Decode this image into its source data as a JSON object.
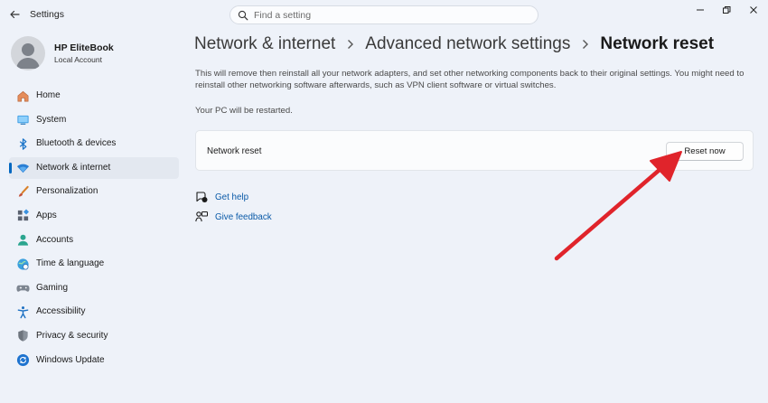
{
  "window": {
    "title": "Settings",
    "search_placeholder": "Find a setting"
  },
  "profile": {
    "name": "HP EliteBook",
    "account_type": "Local Account"
  },
  "sidebar": {
    "items": [
      {
        "label": "Home",
        "icon": "home-icon"
      },
      {
        "label": "System",
        "icon": "system-monitor-icon"
      },
      {
        "label": "Bluetooth & devices",
        "icon": "bluetooth-icon"
      },
      {
        "label": "Network & internet",
        "icon": "wifi-icon",
        "selected": true
      },
      {
        "label": "Personalization",
        "icon": "brush-icon"
      },
      {
        "label": "Apps",
        "icon": "apps-icon"
      },
      {
        "label": "Accounts",
        "icon": "accounts-icon"
      },
      {
        "label": "Time & language",
        "icon": "globe-clock-icon"
      },
      {
        "label": "Gaming",
        "icon": "gamepad-icon"
      },
      {
        "label": "Accessibility",
        "icon": "accessibility-icon"
      },
      {
        "label": "Privacy & security",
        "icon": "shield-icon"
      },
      {
        "label": "Windows Update",
        "icon": "update-icon"
      }
    ]
  },
  "breadcrumb": {
    "level1": "Network & internet",
    "level2": "Advanced network settings",
    "current": "Network reset"
  },
  "content": {
    "description": "This will remove then reinstall all your network adapters, and set other networking components back to their original settings. You might need to reinstall other networking software afterwards, such as VPN client software or virtual switches.",
    "restart_note": "Your PC will be restarted.",
    "card_label": "Network reset",
    "reset_button": "Reset now",
    "get_help": "Get help",
    "give_feedback": "Give feedback"
  },
  "colors": {
    "accent": "#0067c0",
    "link": "#0a5aa8",
    "annotation_arrow": "#e0242b",
    "background": "#eef2f9"
  }
}
